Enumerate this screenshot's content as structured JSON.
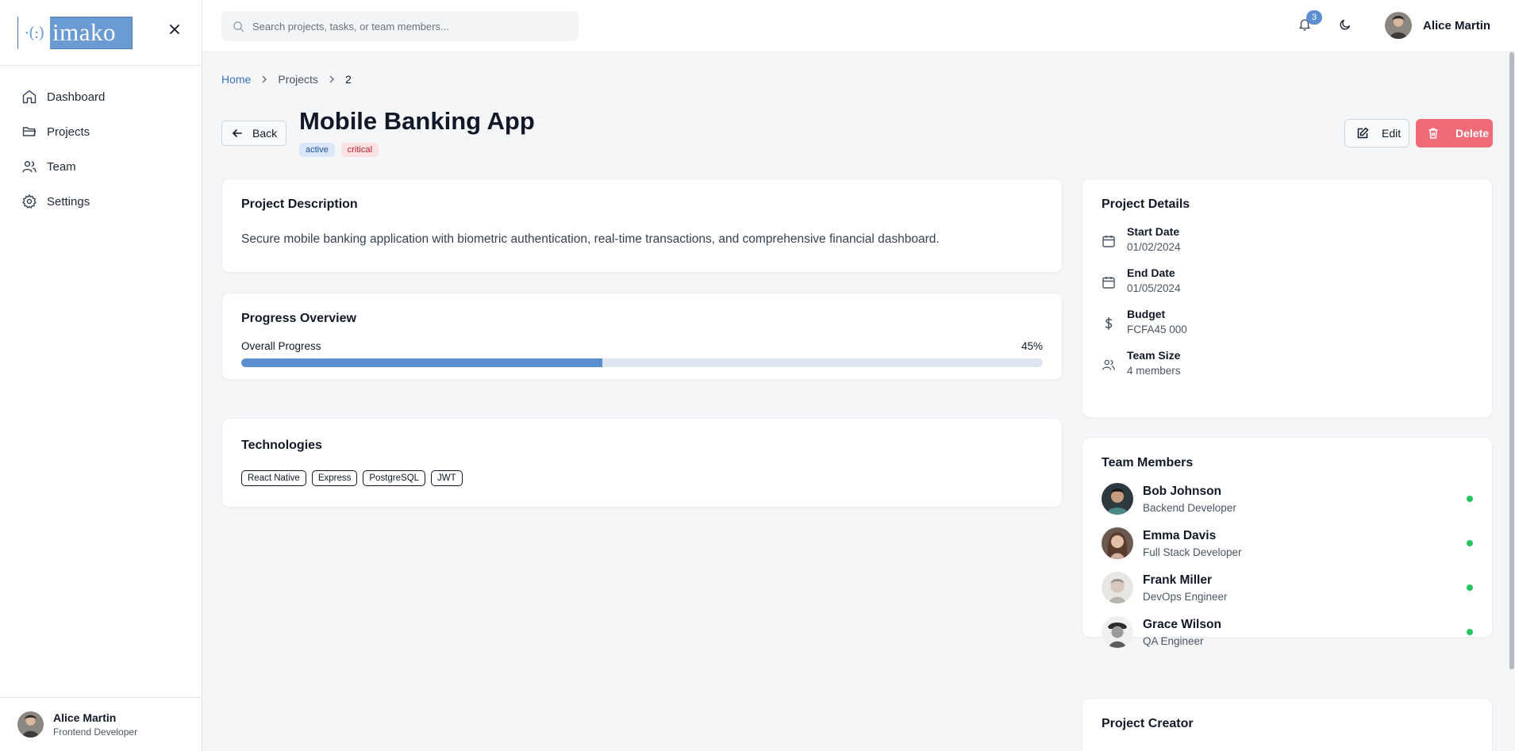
{
  "sidebar": {
    "logo": {
      "mark": "·(:)",
      "word": "imako"
    },
    "items": [
      {
        "label": "Dashboard",
        "icon": "home-icon"
      },
      {
        "label": "Projects",
        "icon": "folder-icon"
      },
      {
        "label": "Team",
        "icon": "users-icon"
      },
      {
        "label": "Settings",
        "icon": "gear-icon"
      }
    ],
    "footer": {
      "name": "Alice Martin",
      "role": "Frontend Developer"
    }
  },
  "header": {
    "search_placeholder": "Search projects, tasks, or team members...",
    "notifications_count": "3",
    "user_name": "Alice Martin"
  },
  "breadcrumb": {
    "home": "Home",
    "projects": "Projects",
    "current": "2"
  },
  "project": {
    "back_label": "Back",
    "title": "Mobile Banking App",
    "tags": [
      "active",
      "critical"
    ],
    "edit_label": "Edit",
    "delete_label": "Delete",
    "description_title": "Project Description",
    "description": "Secure mobile banking application with biometric authentication, real-time transactions, and comprehensive financial dashboard.",
    "progress_title": "Progress Overview",
    "progress_label": "Overall Progress",
    "progress_text": "45%",
    "progress_value": 45,
    "tech_title": "Technologies",
    "technologies": [
      "React Native",
      "Express",
      "PostgreSQL",
      "JWT"
    ]
  },
  "details": {
    "title": "Project Details",
    "items": [
      {
        "label": "Start Date",
        "value": "01/02/2024",
        "icon": "calendar-icon"
      },
      {
        "label": "End Date",
        "value": "01/05/2024",
        "icon": "calendar-icon"
      },
      {
        "label": "Budget",
        "value": "FCFA45 000",
        "icon": "dollar-icon"
      },
      {
        "label": "Team Size",
        "value": "4 members",
        "icon": "users-icon"
      }
    ]
  },
  "team": {
    "title": "Team Members",
    "members": [
      {
        "name": "Bob Johnson",
        "role": "Backend Developer",
        "status": "online"
      },
      {
        "name": "Emma Davis",
        "role": "Full Stack Developer",
        "status": "online"
      },
      {
        "name": "Frank Miller",
        "role": "DevOps Engineer",
        "status": "online"
      },
      {
        "name": "Grace Wilson",
        "role": "QA Engineer",
        "status": "online"
      }
    ]
  },
  "creator": {
    "title": "Project Creator"
  },
  "colors": {
    "accent": "#5b8fd1",
    "danger": "#ef6b77",
    "online": "#22c55e",
    "tag_active_bg": "#dbe7f8",
    "tag_critical_bg": "#fde0e2"
  }
}
